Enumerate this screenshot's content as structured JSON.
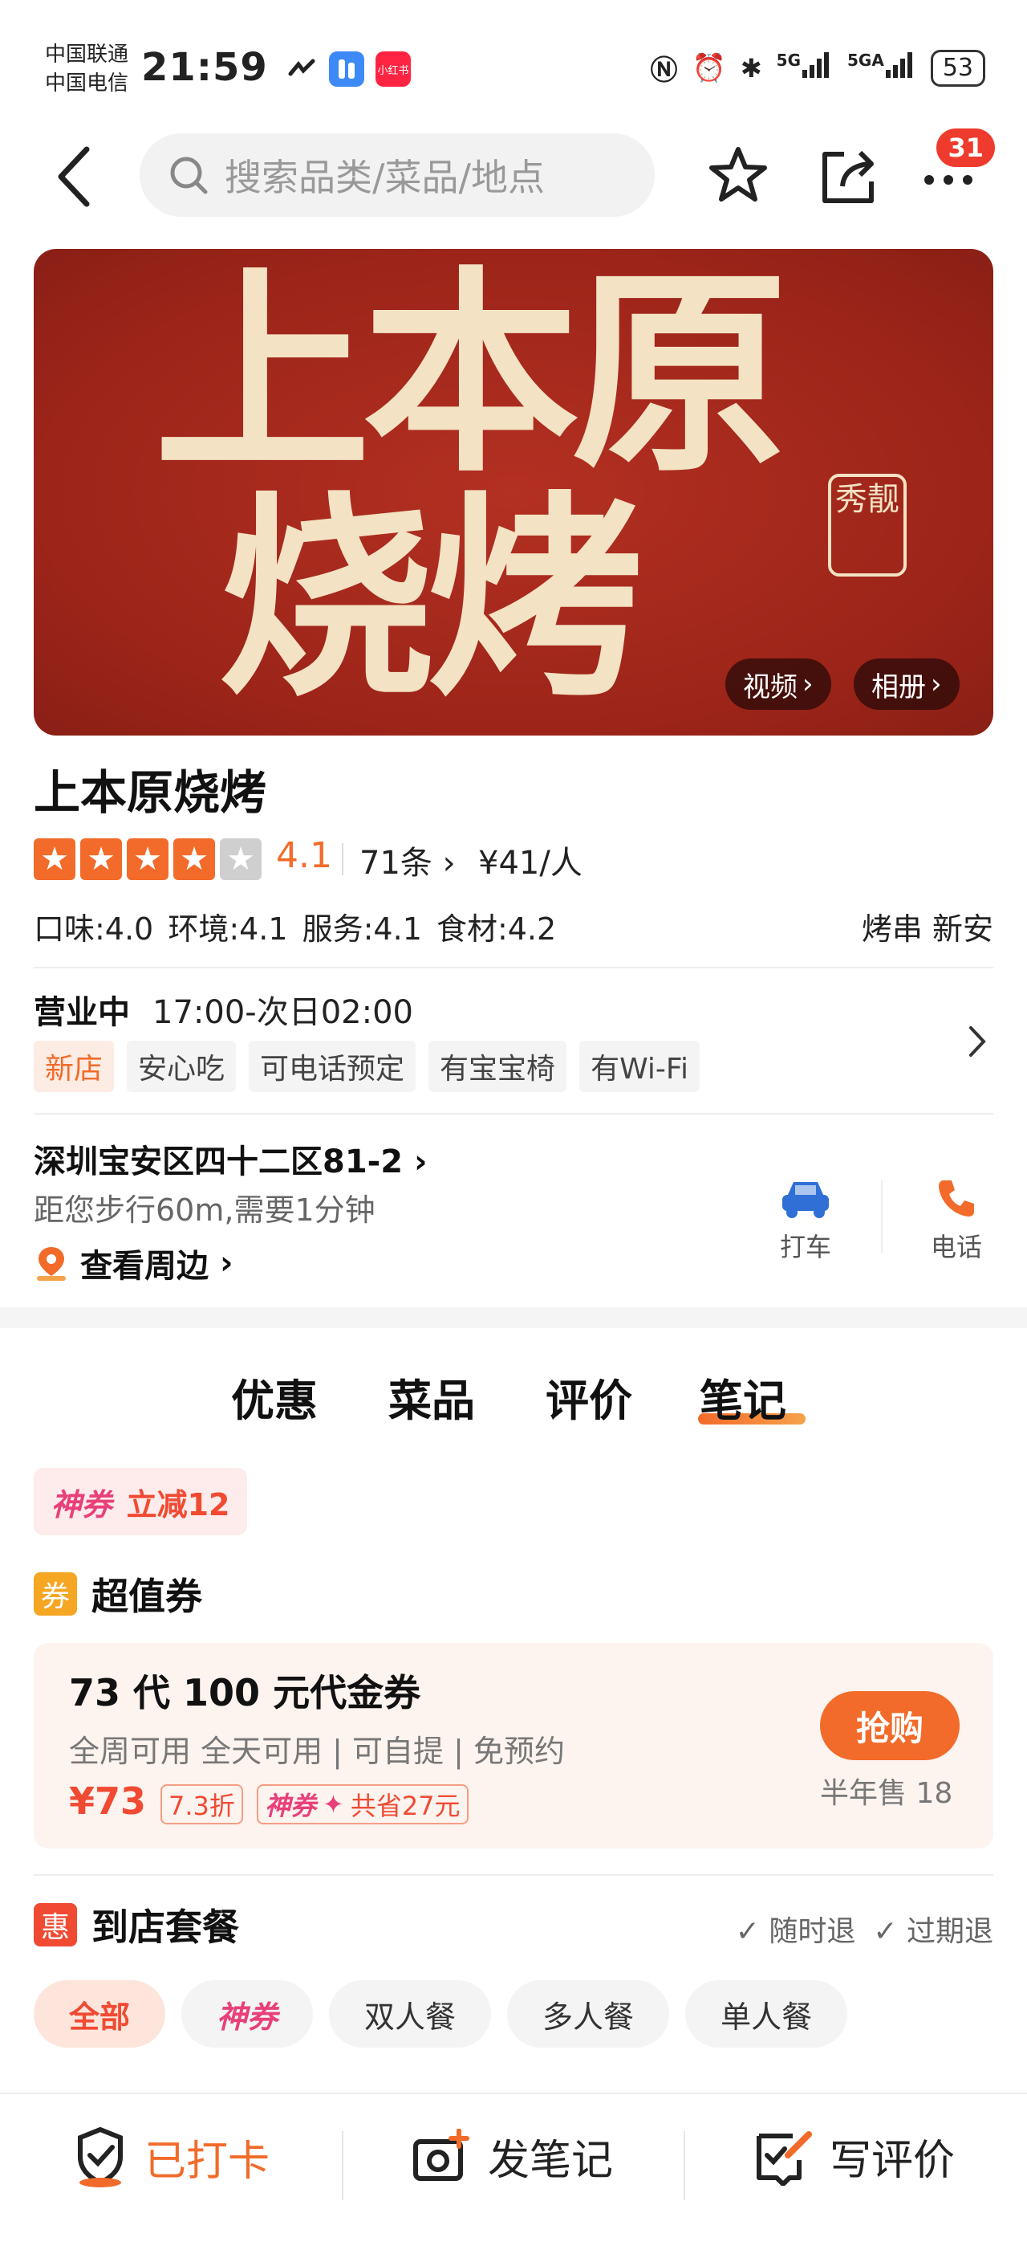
{
  "status_bar": {
    "carrier1": "中国联通",
    "carrier2": "中国电信",
    "time": "21:59",
    "signal1": "5G",
    "signal2": "5GA",
    "battery": "53",
    "app_badge": "小红书"
  },
  "header": {
    "search_placeholder": "搜索品类/菜品/地点",
    "badge_count": "31"
  },
  "banner": {
    "line1": "上本原",
    "line2": "烧烤",
    "seal_text": "秀靓",
    "video_label": "视频",
    "album_label": "相册"
  },
  "shop": {
    "name": "上本原烧烤",
    "rating": "4.1",
    "rating_stars": 4,
    "reviews": "71条",
    "avg_price": "¥41/人",
    "scores": "口味:4.0  环境:4.1  服务:4.1  食材:4.2",
    "categories": "烤串  新安",
    "status": "营业中",
    "hours": "17:00-次日02:00",
    "tags": [
      "新店",
      "安心吃",
      "可电话预定",
      "有宝宝椅",
      "有Wi-Fi"
    ],
    "address": "深圳宝安区四十二区81-2",
    "distance": "距您步行60m,需要1分钟",
    "nearby": "查看周边",
    "taxi_label": "打车",
    "phone_label": "电话"
  },
  "tabs": [
    "优惠",
    "菜品",
    "评价",
    "笔记"
  ],
  "deals": {
    "chip_shen": "神券",
    "chip_discount": "立减12",
    "voucher_section": "超值券",
    "voucher_icon": "券",
    "voucher_title": "73 代 100 元代金券",
    "voucher_desc": "全周可用 全天可用 | 可自提 | 免预约",
    "voucher_price": "¥73",
    "voucher_discount": "7.3折",
    "voucher_save_shen": "神券",
    "voucher_save": "共省27元",
    "buy_label": "抢购",
    "sold": "半年售 18",
    "package_section": "到店套餐",
    "package_icon": "惠",
    "refund1": "随时退",
    "refund2": "过期退",
    "filters": [
      "全部",
      "神券",
      "双人餐",
      "多人餐",
      "单人餐"
    ]
  },
  "bottom_bar": {
    "checkin": "已打卡",
    "post_note": "发笔记",
    "write_review": "写评价"
  },
  "colors": {
    "accent": "#f26b2a",
    "red": "#f04a33",
    "pink": "#e8407a",
    "banner_red": "#9c2419",
    "blue": "#2f6fd6"
  }
}
